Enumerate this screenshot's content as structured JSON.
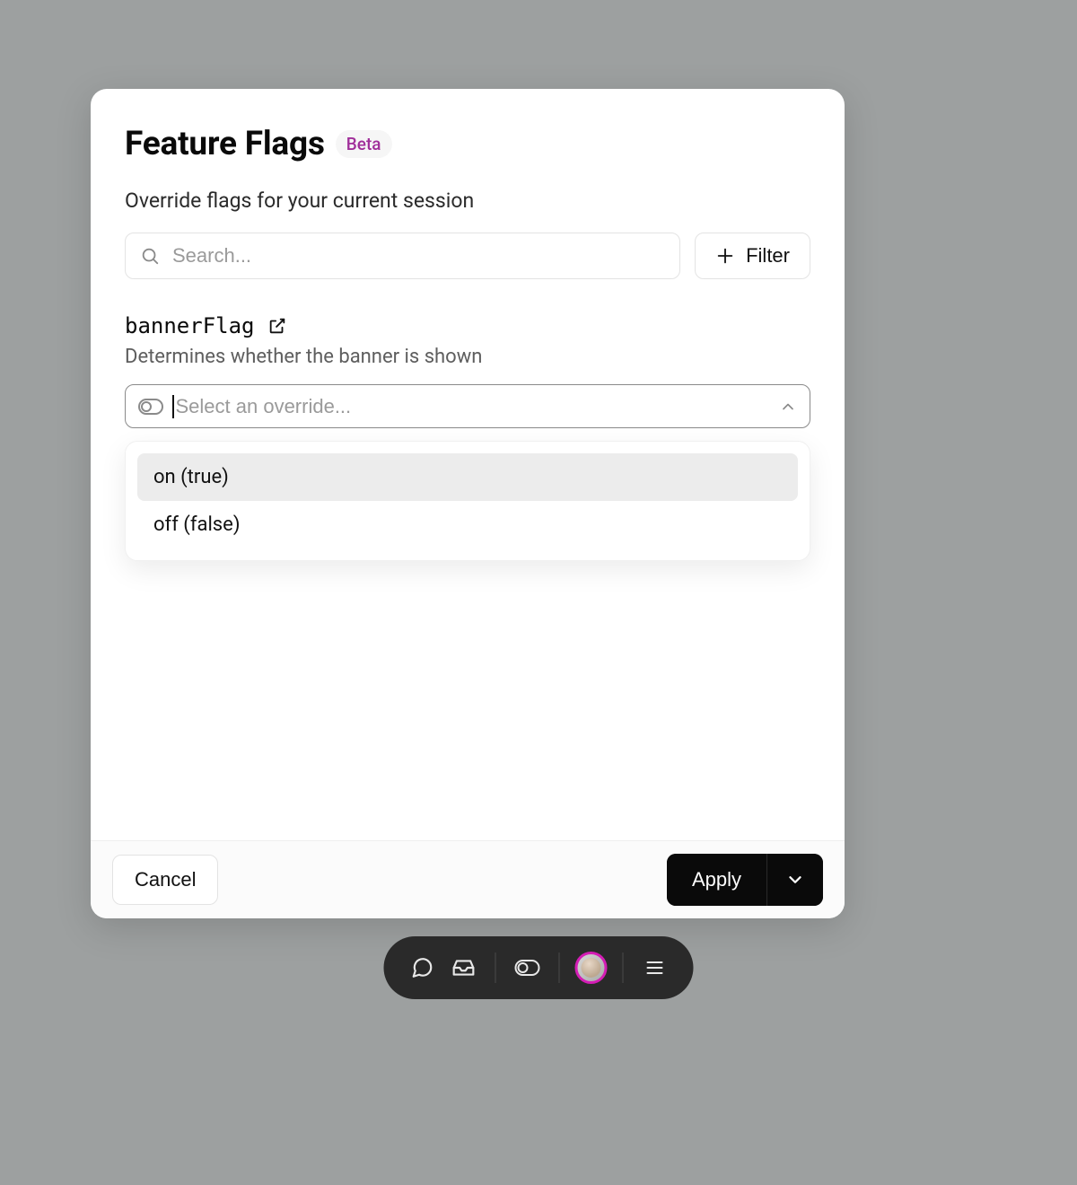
{
  "modal": {
    "title": "Feature Flags",
    "badge": "Beta",
    "subtitle": "Override flags for your current session",
    "search_placeholder": "Search...",
    "filter_label": "Filter"
  },
  "flag": {
    "name": "bannerFlag",
    "description": "Determines whether the banner is shown",
    "override_placeholder": "Select an override...",
    "options": [
      {
        "label": "on (true)",
        "highlighted": true
      },
      {
        "label": "off (false)",
        "highlighted": false
      }
    ]
  },
  "footer": {
    "cancel": "Cancel",
    "apply": "Apply"
  },
  "icons": {
    "search": "search-icon",
    "plus": "plus-icon",
    "external": "external-link-icon",
    "toggle": "toggle-icon",
    "chevron_up": "chevron-up-icon",
    "chevron_down_white": "chevron-down-icon",
    "comment": "comment-icon",
    "inbox": "inbox-icon",
    "eye": "eye-icon",
    "menu": "menu-icon"
  }
}
